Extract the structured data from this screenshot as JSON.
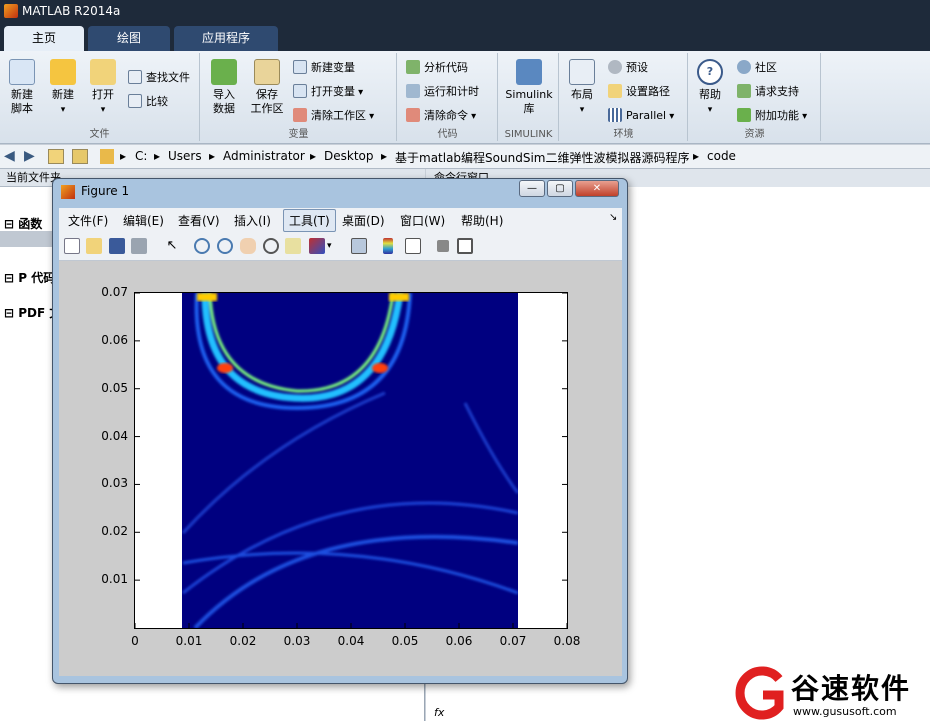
{
  "window": {
    "title": "MATLAB R2014a"
  },
  "tabs": [
    "主页",
    "绘图",
    "应用程序"
  ],
  "ribbon": {
    "groups": {
      "file": "文件",
      "variable": "变量",
      "code": "代码",
      "simulink": "SIMULINK",
      "env": "环境",
      "resources": "资源"
    },
    "new_script": "新建\n脚本",
    "new": "新建",
    "open": "打开",
    "find_files": "查找文件",
    "compare": "比较",
    "import_data": "导入\n数据",
    "save_workspace": "保存\n工作区",
    "new_variable": "新建变量",
    "open_variable": "打开变量",
    "clear_workspace": "清除工作区",
    "analyze_code": "分析代码",
    "run_and_time": "运行和计时",
    "clear_commands": "清除命令",
    "simulink_lib": "Simulink\n库",
    "layout": "布局",
    "preferences": "预设",
    "set_path": "设置路径",
    "parallel": "Parallel",
    "help": "帮助",
    "community": "社区",
    "request_support": "请求支持",
    "addons": "附加功能"
  },
  "address": {
    "crumbs": [
      "C:",
      "Users",
      "Administrator",
      "Desktop",
      "基于matlab编程SoundSim二维弹性波模拟器源码程序",
      "code"
    ]
  },
  "left_panel": {
    "title": "当前文件夹",
    "sections": [
      "函数",
      "P 代码",
      "PDF 文"
    ]
  },
  "right_panel": {
    "title": "命令行窗口"
  },
  "figure": {
    "title": "Figure 1",
    "menu": [
      "文件(F)",
      "编辑(E)",
      "查看(V)",
      "插入(I)",
      "工具(T)",
      "桌面(D)",
      "窗口(W)",
      "帮助(H)"
    ]
  },
  "chart_data": {
    "type": "heatmap",
    "title": "",
    "xlabel": "",
    "ylabel": "",
    "xlim": [
      0,
      0.08
    ],
    "ylim": [
      0,
      0.07
    ],
    "x_ticks": [
      "0",
      "0.01",
      "0.02",
      "0.03",
      "0.04",
      "0.05",
      "0.06",
      "0.07",
      "0.08"
    ],
    "y_ticks": [
      "0.01",
      "0.02",
      "0.03",
      "0.04",
      "0.05",
      "0.06",
      "0.07"
    ],
    "image_extent_x": [
      0,
      0.07
    ],
    "colormap": "jet",
    "background_color": "#000080"
  },
  "watermark": {
    "text": "谷速软件",
    "url": "www.gususoft.com"
  }
}
